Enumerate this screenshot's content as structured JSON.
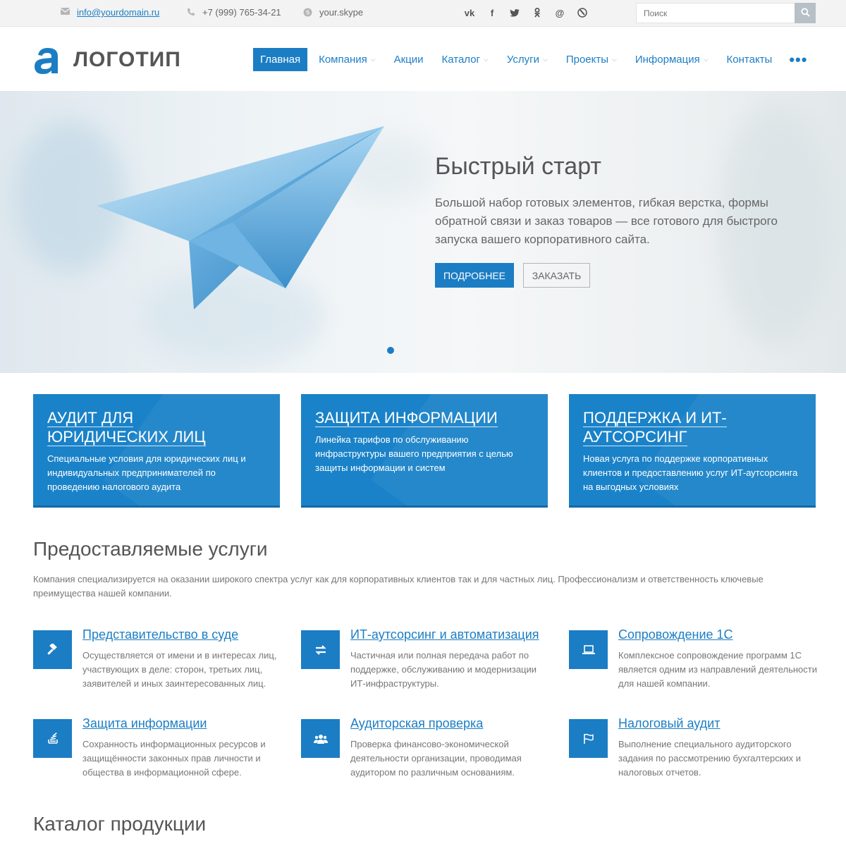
{
  "topbar": {
    "email": "info@yourdomain.ru",
    "phone": "+7 (999) 765-34-21",
    "skype": "your.skype",
    "socials": [
      "vk-icon",
      "facebook-icon",
      "twitter-icon",
      "odnoklassniki-icon",
      "mail-icon",
      "livejournal-icon"
    ],
    "search_placeholder": "Поиск"
  },
  "header": {
    "logo_text": "ЛОГОТИП",
    "nav": [
      {
        "label": "Главная",
        "active": true,
        "dropdown": false
      },
      {
        "label": "Компания",
        "active": false,
        "dropdown": true
      },
      {
        "label": "Акции",
        "active": false,
        "dropdown": false
      },
      {
        "label": "Каталог",
        "active": false,
        "dropdown": true
      },
      {
        "label": "Услуги",
        "active": false,
        "dropdown": true
      },
      {
        "label": "Проекты",
        "active": false,
        "dropdown": true
      },
      {
        "label": "Информация",
        "active": false,
        "dropdown": true
      },
      {
        "label": "Контакты",
        "active": false,
        "dropdown": false
      }
    ],
    "more": "•••"
  },
  "hero": {
    "title": "Быстрый старт",
    "text": "Большой набор готовых элементов, гибкая верстка, формы обратной связи и заказ товаров — все готового для быстрого запуска вашего корпоративного сайта.",
    "btn_more": "ПОДРОБНЕЕ",
    "btn_order": "ЗАКАЗАТЬ"
  },
  "tiles": [
    {
      "title": "Аудит для юридических лиц",
      "text": "Специальные условия для юридических лиц и индивидуальных предпринимателей по проведению налогового аудита"
    },
    {
      "title": "Защита информации",
      "text": "Линейка тарифов по обслуживанию инфраструктуры вашего предприятия с целью защиты информации и систем"
    },
    {
      "title": "Поддержка и ИТ-аутсорсинг",
      "text": "Новая услуга по поддержке корпоративных клиентов и предоставлению услуг ИТ-аутсорсинга на выгодных условиях"
    }
  ],
  "services": {
    "title": "Предоставляемые услуги",
    "desc": "Компания специализируется на оказании широкого спектра услуг как для корпоративных клиентов так и для частных лиц. Профессионализм и ответственность ключевые преимущества нашей компании.",
    "items": [
      {
        "icon": "gavel-icon",
        "title": "Представительство в суде",
        "text": "Осуществляется от имени и в интересах лиц, участвующих в деле: сторон, третьих лиц, заявителей и иных заинтересованных лиц."
      },
      {
        "icon": "exchange-icon",
        "title": "ИТ-аутсорсинг и автоматизация",
        "text": "Частичная или полная передача работ по поддержке, обслуживанию и модернизации ИТ-инфраструктуры."
      },
      {
        "icon": "laptop-icon",
        "title": "Сопровождение 1С",
        "text": "Комплексное сопровождение программ 1С является одним из направлений деятельности для нашей компании."
      },
      {
        "icon": "stack-icon",
        "title": "Защита информации",
        "text": "Сохранность информационных ресурсов и защищённости законных прав личности и общества в информационной сфере."
      },
      {
        "icon": "users-icon",
        "title": "Аудиторская проверка",
        "text": "Проверка финансово-экономической деятельности организации, проводимая аудитором по различным основаниям."
      },
      {
        "icon": "flag-icon",
        "title": "Налоговый аудит",
        "text": "Выполнение специального аудиторского задания по рассмотрению бухгалтерских и налоговых отчетов."
      }
    ]
  },
  "catalog": {
    "title": "Каталог продукции"
  }
}
